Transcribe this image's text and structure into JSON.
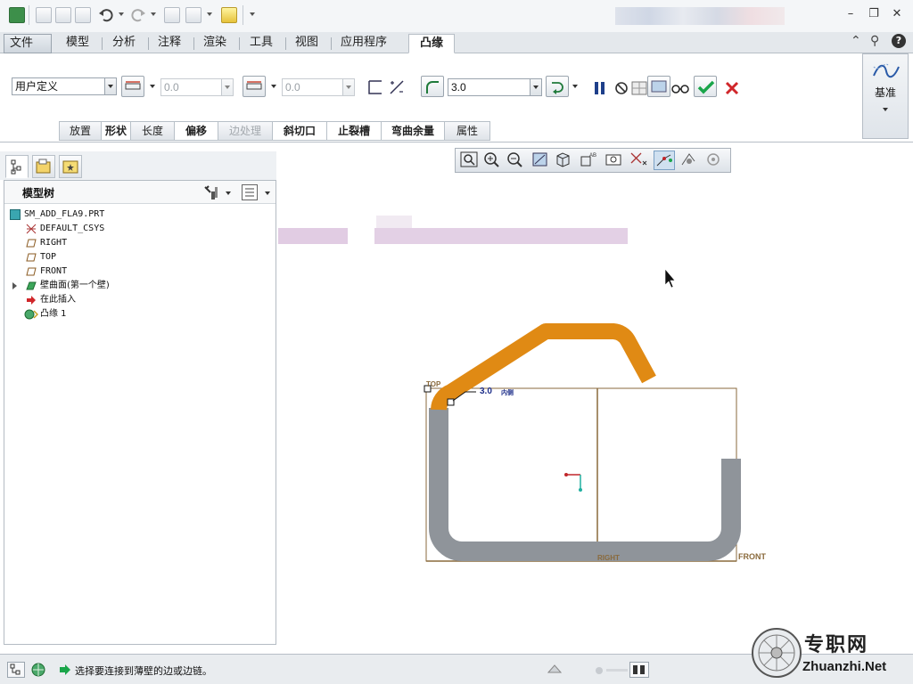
{
  "ribbon": {
    "tabs": [
      {
        "label": "文件"
      },
      {
        "label": "模型"
      },
      {
        "label": "分析"
      },
      {
        "label": "注释"
      },
      {
        "label": "渲染"
      },
      {
        "label": "工具"
      },
      {
        "label": "视图"
      },
      {
        "label": "应用程序"
      },
      {
        "label": "凸缘"
      }
    ],
    "active_tab": "凸缘"
  },
  "dashboard": {
    "shape_combo": "用户定义",
    "length1_value": "0.0",
    "length2_value": "0.0",
    "radius_value": "3.0",
    "subtabs": [
      {
        "label": "放置"
      },
      {
        "label": "形状"
      },
      {
        "label": "长度"
      },
      {
        "label": "偏移"
      },
      {
        "label": "边处理"
      },
      {
        "label": "斜切口"
      },
      {
        "label": "止裂槽"
      },
      {
        "label": "弯曲余量"
      },
      {
        "label": "属性"
      }
    ],
    "datum_label": "基准"
  },
  "model_tree": {
    "title": "模型树",
    "nodes": [
      {
        "label": "SM_ADD_FLA9.PRT"
      },
      {
        "label": "DEFAULT_CSYS"
      },
      {
        "label": "RIGHT"
      },
      {
        "label": "TOP"
      },
      {
        "label": "FRONT"
      },
      {
        "label": "壁曲面(第一个壁)"
      },
      {
        "label": "在此插入"
      },
      {
        "label": "凸缘 1"
      }
    ]
  },
  "graphics": {
    "label_top": "TOP",
    "label_right": "RIGHT",
    "label_front": "FRONT",
    "dim_value": "3.0",
    "dim_side": "内侧"
  },
  "status": {
    "message": "选择要连接到薄壁的边或边链。"
  },
  "watermark": {
    "text": "专职网",
    "url": "Zhuanzhi.Net"
  },
  "colors": {
    "flange": "#e08a14",
    "wall": "#8f949a",
    "datum": "#8a6a3c",
    "accent_check": "#1aa54a",
    "accent_cancel": "#d0262a"
  }
}
